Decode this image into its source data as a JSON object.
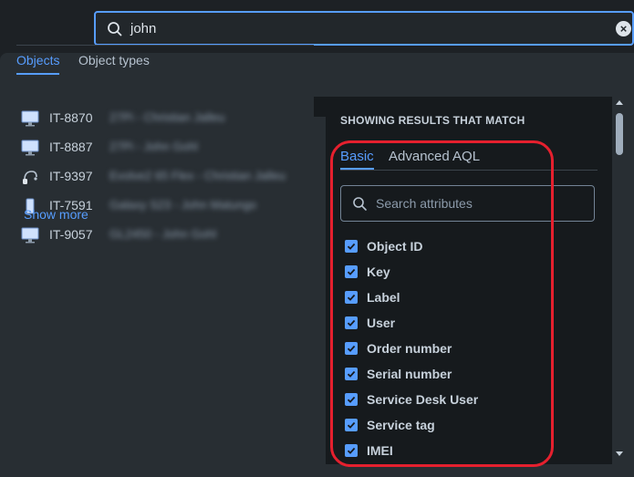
{
  "search": {
    "value": "john"
  },
  "tabs": [
    {
      "label": "Objects",
      "active": true
    },
    {
      "label": "Object types",
      "active": false
    }
  ],
  "results": [
    {
      "icon": "monitor-icon",
      "key": "IT-8870",
      "title": "27Pi - Christian Jalleu"
    },
    {
      "icon": "monitor-icon",
      "key": "IT-8887",
      "title": "27Pi - John Gohl"
    },
    {
      "icon": "headset-icon",
      "key": "IT-9397",
      "title": "Evolve2 65 Flex - Christian Jalleu"
    },
    {
      "icon": "phone-icon",
      "key": "IT-7591",
      "title": "Galaxy S23 - John Matungo"
    },
    {
      "icon": "monitor-icon",
      "key": "IT-9057",
      "title": "GL2450 - John Gohl"
    }
  ],
  "show_more": "Show more",
  "panel": {
    "heading": "SHOWING RESULTS THAT MATCH",
    "tabs": [
      {
        "label": "Basic",
        "active": true
      },
      {
        "label": "Advanced AQL",
        "active": false
      }
    ],
    "attr_search_placeholder": "Search attributes",
    "attributes": [
      {
        "label": "Object ID",
        "checked": true
      },
      {
        "label": "Key",
        "checked": true
      },
      {
        "label": "Label",
        "checked": true
      },
      {
        "label": "User",
        "checked": true
      },
      {
        "label": "Order number",
        "checked": true
      },
      {
        "label": "Serial number",
        "checked": true
      },
      {
        "label": "Service Desk User",
        "checked": true
      },
      {
        "label": "Service tag",
        "checked": true
      },
      {
        "label": "IMEI",
        "checked": true
      }
    ]
  },
  "colors": {
    "accent": "#579dff",
    "highlight": "#e5202e",
    "background": "#1d2125",
    "surface": "#282e33",
    "panel": "#161a1d"
  }
}
